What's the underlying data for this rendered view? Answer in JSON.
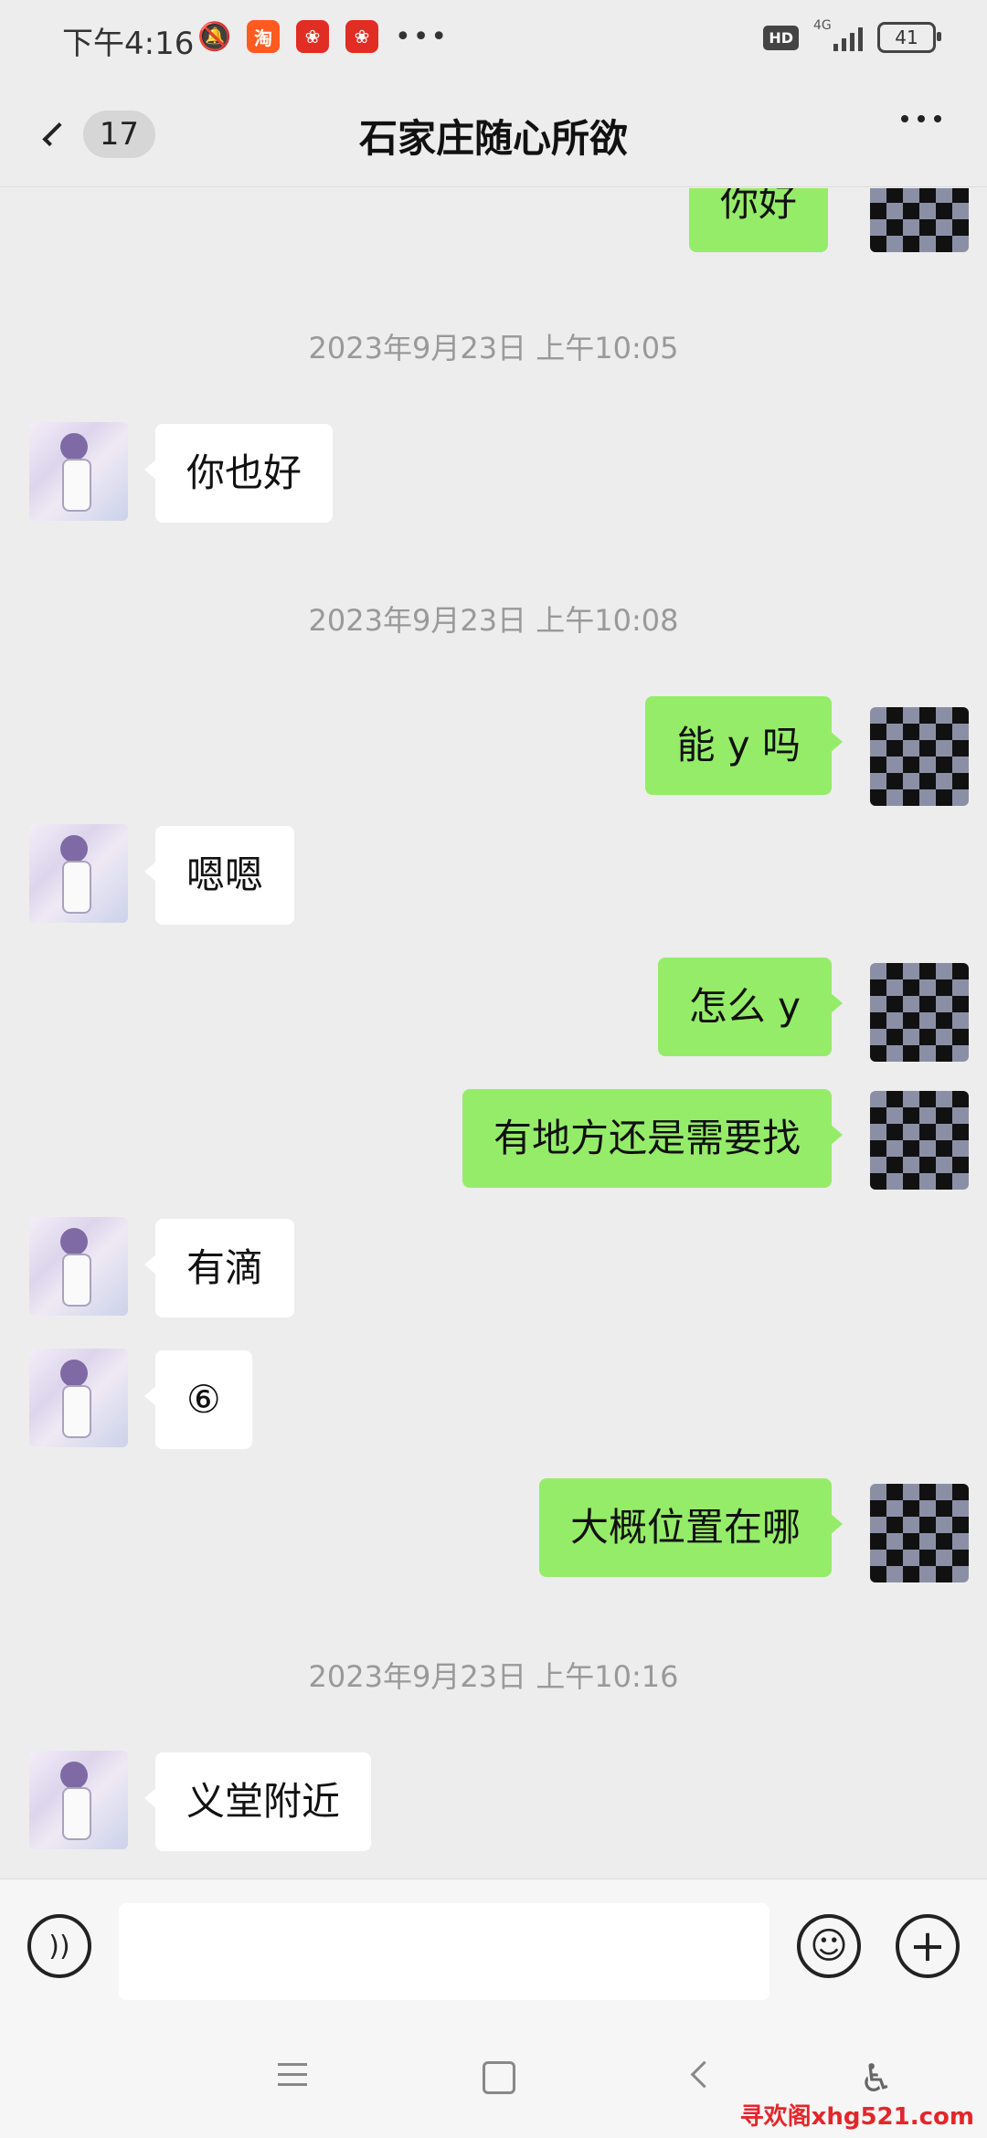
{
  "status_bar": {
    "time": "下午4:16",
    "taobao_icon_label": "淘",
    "network": "4G",
    "hd_label": "HD",
    "battery": "41"
  },
  "header": {
    "unread_count": "17",
    "title": "石家庄随心所欲"
  },
  "messages": [
    {
      "type": "self",
      "text": "你好"
    },
    {
      "type": "timestamp",
      "text": "2023年9月23日 上午10:05"
    },
    {
      "type": "other",
      "text": "你也好"
    },
    {
      "type": "timestamp",
      "text": "2023年9月23日 上午10:08"
    },
    {
      "type": "self",
      "text": "能 y 吗"
    },
    {
      "type": "other",
      "text": "嗯嗯"
    },
    {
      "type": "self",
      "text": "怎么 y"
    },
    {
      "type": "self",
      "text": "有地方还是需要找"
    },
    {
      "type": "other",
      "text": "有滴"
    },
    {
      "type": "other",
      "text": "⑥"
    },
    {
      "type": "self",
      "text": "大概位置在哪"
    },
    {
      "type": "timestamp",
      "text": "2023年9月23日 上午10:16"
    },
    {
      "type": "other",
      "text": "义堂附近"
    }
  ],
  "input_bar": {
    "message_value": "",
    "voice_icon": "voice-icon",
    "emoji_icon": "emoji-icon",
    "plus_icon": "plus-icon"
  },
  "watermark": "寻欢阁xhg521.com"
}
